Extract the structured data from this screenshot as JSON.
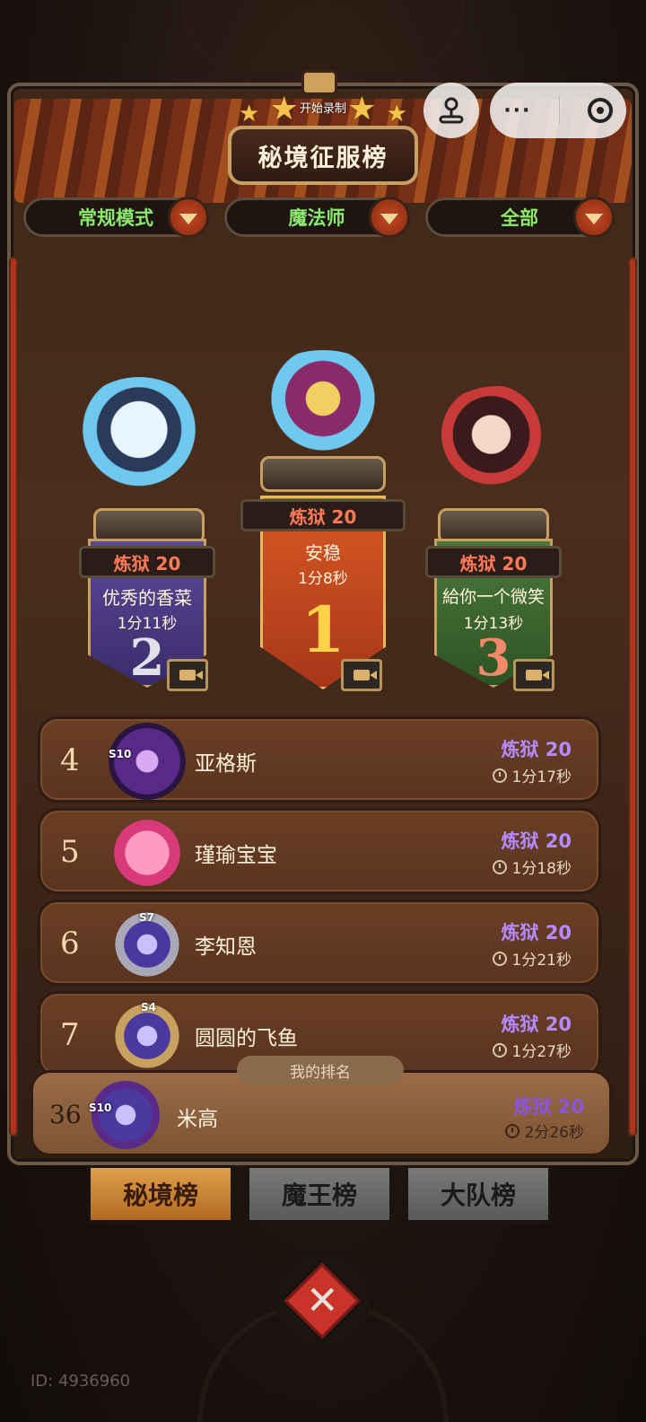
{
  "header": {
    "title": "秘境征服榜",
    "record_label": "开始录制"
  },
  "filters": [
    {
      "label": "常规模式"
    },
    {
      "label": "魔法师"
    },
    {
      "label": "全部"
    }
  ],
  "podium": [
    {
      "rank": "1",
      "level": "炼狱 20",
      "name": "安稳",
      "time": "1分8秒",
      "color": "#c8461e"
    },
    {
      "rank": "2",
      "level": "炼狱 20",
      "name": "优秀的香菜",
      "time": "1分11秒",
      "color": "#4a3a8a"
    },
    {
      "rank": "3",
      "level": "炼狱 20",
      "name": "給你一个微笑",
      "time": "1分13秒",
      "color": "#3e6a30"
    }
  ],
  "rows": [
    {
      "rank": "4",
      "name": "亚格斯",
      "level": "炼狱 20",
      "time": "1分17秒",
      "season": "S10"
    },
    {
      "rank": "5",
      "name": "瑾瑜宝宝",
      "level": "炼狱 20",
      "time": "1分18秒",
      "season": ""
    },
    {
      "rank": "6",
      "name": "李知恩",
      "level": "炼狱 20",
      "time": "1分21秒",
      "season": "S7"
    },
    {
      "rank": "7",
      "name": "圆圆的飞鱼",
      "level": "炼狱 20",
      "time": "1分27秒",
      "season": "S4"
    }
  ],
  "my_rank": {
    "tag": "我的排名",
    "rank": "36",
    "name": "米高",
    "level": "炼狱 20",
    "time": "2分26秒",
    "season": "S10"
  },
  "tabs": [
    {
      "label": "秘境榜",
      "active": true
    },
    {
      "label": "魔王榜",
      "active": false
    },
    {
      "label": "大队榜",
      "active": false
    }
  ],
  "footer": {
    "id_text": "ID: 4936960"
  },
  "icons": {
    "capsule_more": "···",
    "close": "✕"
  }
}
